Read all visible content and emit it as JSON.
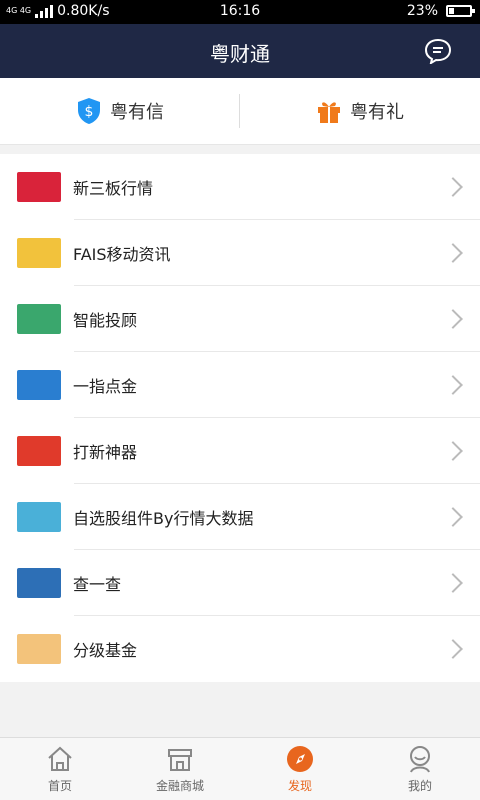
{
  "status_bar": {
    "network_type": "4G 4G",
    "speed": "0.80K/s",
    "time": "16:16",
    "battery_percent": "23%",
    "battery_level": 0.23
  },
  "header": {
    "title": "粤财通",
    "message_icon": "chat-bubble-icon"
  },
  "top_tabs": [
    {
      "label": "粤有信",
      "icon": "shield-dollar-icon",
      "color": "#2196f3"
    },
    {
      "label": "粤有礼",
      "icon": "gift-icon",
      "color": "#f07a1b"
    }
  ],
  "list": {
    "items": [
      {
        "label": "新三板行情",
        "thumb_color": "#d9233a"
      },
      {
        "label": "FAIS移动资讯",
        "thumb_color": "#f2c23c"
      },
      {
        "label": "智能投顾",
        "thumb_color": "#3aa76d"
      },
      {
        "label": "一指点金",
        "thumb_color": "#2a7ed0"
      },
      {
        "label": "打新神器",
        "thumb_color": "#e03a2b"
      },
      {
        "label": "自选股组件By行情大数据",
        "thumb_color": "#4ab0d8"
      },
      {
        "label": "查一查",
        "thumb_color": "#2d6fb6"
      },
      {
        "label": "分级基金",
        "thumb_color": "#f3c37b"
      }
    ]
  },
  "bottom_nav": [
    {
      "label": "首页",
      "icon": "home-icon",
      "active": false
    },
    {
      "label": "金融商城",
      "icon": "store-icon",
      "active": false
    },
    {
      "label": "发现",
      "icon": "compass-icon",
      "active": true
    },
    {
      "label": "我的",
      "icon": "user-icon",
      "active": false
    }
  ],
  "colors": {
    "header_bg": "#1f2845",
    "accent": "#e8661e"
  }
}
